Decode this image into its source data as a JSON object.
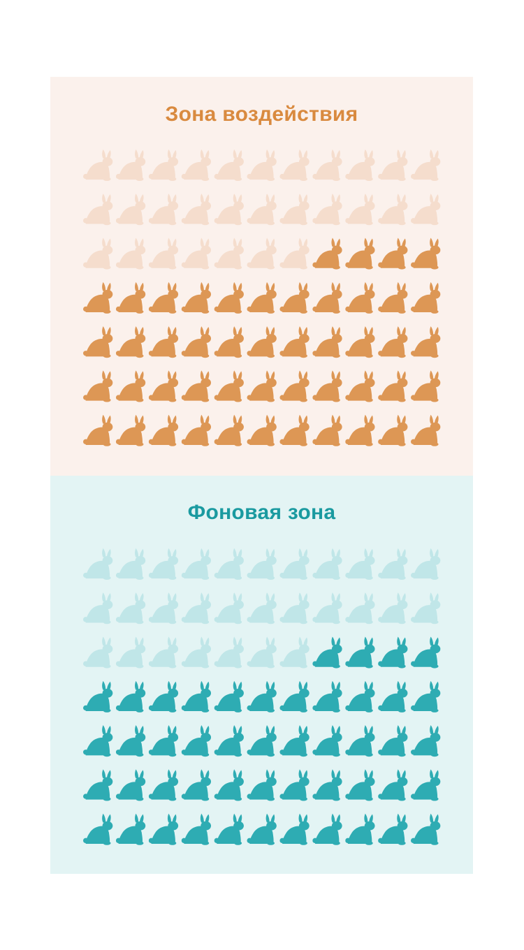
{
  "chart_data": [
    {
      "type": "pictogram",
      "title": "Зона воздействия",
      "icon": "rabbit-icon",
      "rows": 7,
      "columns": 11,
      "total": 77,
      "highlighted": 48,
      "colors": {
        "title": "#d98a3f",
        "highlighted": "#dd9755",
        "faded": "#f5ddcd",
        "background": "#fbf1ec"
      }
    },
    {
      "type": "pictogram",
      "title": "Фоновая зона",
      "icon": "rabbit-icon",
      "rows": 7,
      "columns": 11,
      "total": 77,
      "highlighted": 48,
      "colors": {
        "title": "#1a9aa0",
        "highlighted": "#2eacb3",
        "faded": "#c0e6e8",
        "background": "#e3f4f4"
      }
    }
  ]
}
